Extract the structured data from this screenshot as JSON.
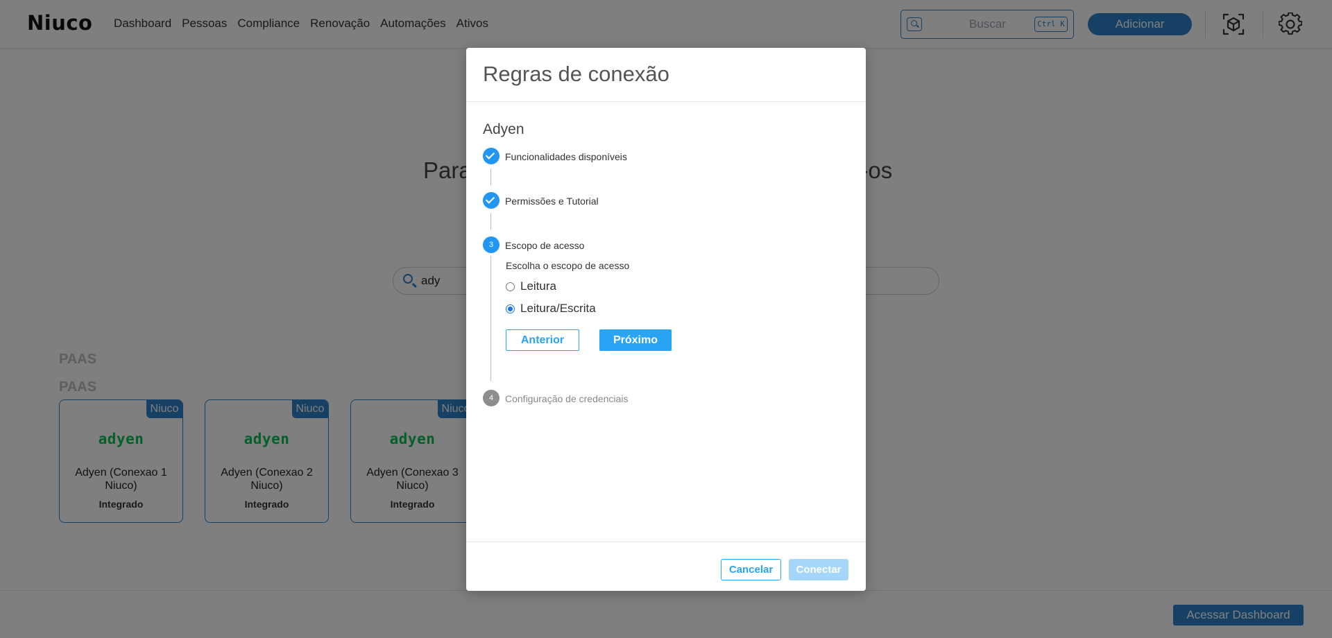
{
  "header": {
    "logo": "Niuco",
    "nav": [
      "Dashboard",
      "Pessoas",
      "Compliance",
      "Renovação",
      "Automações",
      "Ativos"
    ],
    "search_placeholder": "Buscar",
    "search_shortcut": "Ctrl K",
    "add_label": "Adicionar",
    "accent_color": "#2d83c8"
  },
  "background": {
    "title_left": "Para",
    "title_right": "e-os",
    "search_value": "ady",
    "sections": [
      "PAAS",
      "PAAS"
    ],
    "cards": [
      {
        "badge": "Niuco",
        "brand": "adyen",
        "name": "Adyen (Conexao 1 Niuco)",
        "status": "Integrado"
      },
      {
        "badge": "Niuco",
        "brand": "adyen",
        "name": "Adyen (Conexao 2 Niuco)",
        "status": "Integrado"
      },
      {
        "badge": "Niuco",
        "brand": "adyen",
        "name": "Adyen (Conexao 3 Niuco)",
        "status": "Integrado"
      }
    ],
    "dashboard_button": "Acessar Dashboard"
  },
  "modal": {
    "title": "Regras de conexão",
    "provider": "Adyen",
    "steps": [
      {
        "number": "1",
        "label": "Funcionalidades disponíveis",
        "state": "done"
      },
      {
        "number": "2",
        "label": "Permissões e Tutorial",
        "state": "done"
      },
      {
        "number": "3",
        "label": "Escopo de acesso",
        "state": "active"
      },
      {
        "number": "4",
        "label": "Configuração de credenciais",
        "state": "pending"
      }
    ],
    "scope_prompt": "Escolha o escopo de acesso",
    "scope_options": [
      {
        "label": "Leitura",
        "selected": false
      },
      {
        "label": "Leitura/Escrita",
        "selected": true
      }
    ],
    "prev_label": "Anterior",
    "next_label": "Próximo",
    "cancel_label": "Cancelar",
    "connect_label": "Conectar",
    "step_color": "#2196f3"
  }
}
